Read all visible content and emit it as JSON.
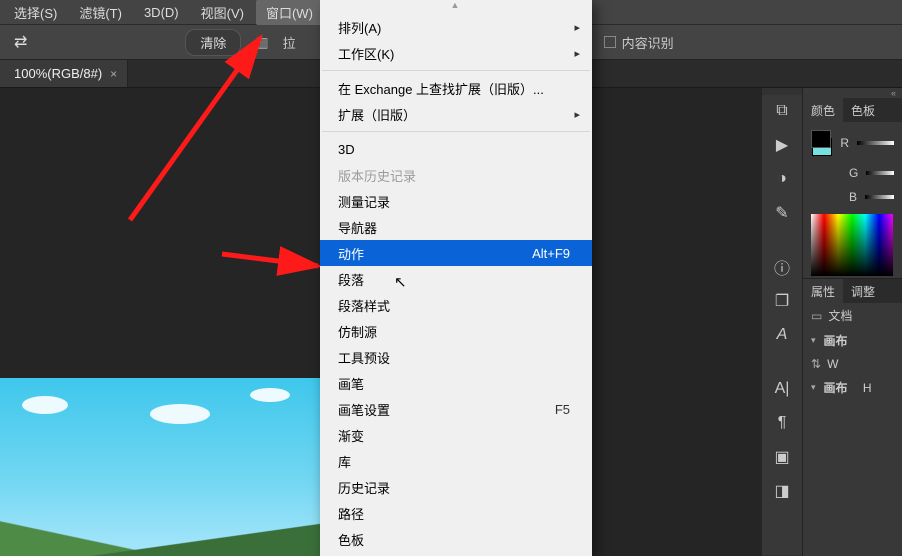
{
  "menubar": [
    {
      "label": "选择(S)"
    },
    {
      "label": "滤镜(T)"
    },
    {
      "label": "3D(D)"
    },
    {
      "label": "视图(V)"
    },
    {
      "label": "窗口(W)",
      "open": true
    }
  ],
  "optbar": {
    "clear": "清除",
    "lasso_prefix": "拉",
    "content_aware": "内容识别"
  },
  "doc_tab": {
    "label": "100%(RGB/8#)",
    "close": "×"
  },
  "dropdown": {
    "groups": [
      [
        {
          "label": "排列(A)",
          "sub": true
        },
        {
          "label": "工作区(K)",
          "sub": true
        }
      ],
      [
        {
          "label": "在 Exchange 上查找扩展（旧版）..."
        },
        {
          "label": "扩展（旧版）",
          "sub": true
        }
      ],
      [
        {
          "label": "3D"
        },
        {
          "label": "版本历史记录",
          "dis": true
        },
        {
          "label": "测量记录"
        },
        {
          "label": "导航器"
        },
        {
          "label": "动作",
          "shortcut": "Alt+F9",
          "hl": true
        },
        {
          "label": "段落"
        },
        {
          "label": "段落样式"
        },
        {
          "label": "仿制源"
        },
        {
          "label": "工具预设"
        },
        {
          "label": "画笔"
        },
        {
          "label": "画笔设置",
          "shortcut": "F5"
        },
        {
          "label": "渐变"
        },
        {
          "label": "库"
        },
        {
          "label": "历史记录"
        },
        {
          "label": "路径"
        },
        {
          "label": "色板"
        }
      ]
    ]
  },
  "right": {
    "tabs1": [
      "颜色",
      "色板"
    ],
    "rgb": [
      "R",
      "G",
      "B"
    ],
    "tabs2": [
      "属性",
      "调整"
    ],
    "doc_label": "文档",
    "brush_hdr": "画布",
    "w_label": "W",
    "brush_hdr2": "画布",
    "h_label": "H"
  }
}
